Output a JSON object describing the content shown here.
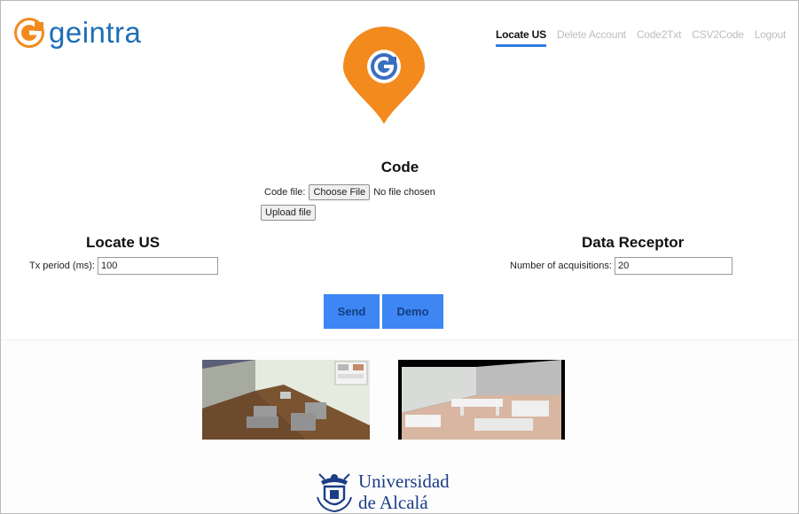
{
  "brand": {
    "name": "geintra",
    "color": "#1d6fb6",
    "accent": "#f28a1d"
  },
  "nav": {
    "items": [
      {
        "label": "Locate US",
        "active": true
      },
      {
        "label": "Delete Account",
        "active": false
      },
      {
        "label": "Code2Txt",
        "active": false
      },
      {
        "label": "CSV2Code",
        "active": false
      },
      {
        "label": "Logout",
        "active": false
      }
    ]
  },
  "code": {
    "title": "Code",
    "file_label": "Code file:",
    "choose_label": "Choose File",
    "file_status": "No file chosen",
    "upload_label": "Upload file"
  },
  "locate": {
    "title": "Locate US",
    "tx_label": "Tx period (ms):",
    "tx_value": "100"
  },
  "receptor": {
    "title": "Data Receptor",
    "acq_label": "Number of acquisitions:",
    "acq_value": "20"
  },
  "actions": {
    "send_label": "Send",
    "demo_label": "Demo",
    "button_color": "#3d86f4"
  },
  "university": {
    "line1": "Universidad",
    "line2": "de Alcalá",
    "color": "#1b3d86"
  }
}
